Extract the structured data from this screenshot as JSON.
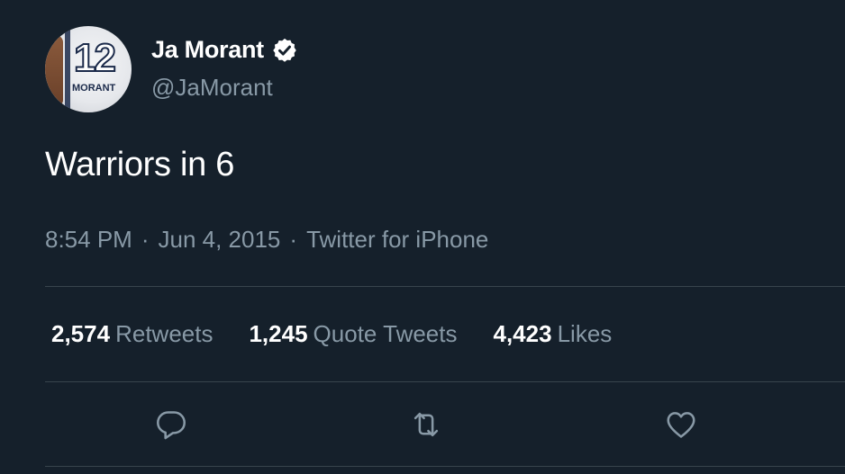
{
  "tweet": {
    "author": {
      "display_name": "Ja Morant",
      "handle": "@JaMorant",
      "verified": true,
      "avatar": {
        "jersey_number": "12",
        "jersey_name": "MORANT"
      }
    },
    "text": "Warriors in 6",
    "time": "8:54 PM",
    "date": "Jun 4, 2015",
    "source": "Twitter for iPhone",
    "separator": "·",
    "stats": [
      {
        "count": "2,574",
        "label": "Retweets"
      },
      {
        "count": "1,245",
        "label": "Quote Tweets"
      },
      {
        "count": "4,423",
        "label": "Likes"
      }
    ],
    "actions": [
      "reply-icon",
      "retweet-icon",
      "like-icon"
    ]
  },
  "colors": {
    "background": "#15202b",
    "primary_text": "#ffffff",
    "secondary_text": "#8899a6",
    "divider": "#38444d"
  }
}
